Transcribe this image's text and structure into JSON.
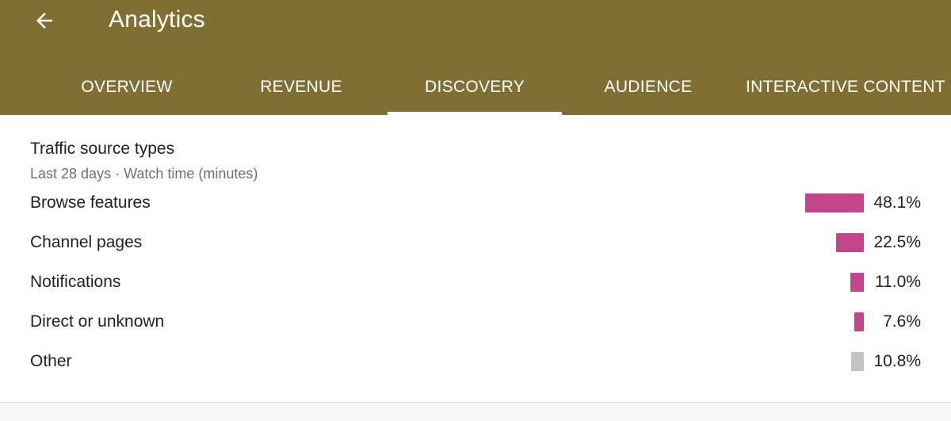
{
  "appbar": {
    "title": "Analytics",
    "back_icon": "arrow-left-icon",
    "background_color": "#806f33"
  },
  "tabs": [
    {
      "label": "OVERVIEW",
      "active": false
    },
    {
      "label": "REVENUE",
      "active": false
    },
    {
      "label": "DISCOVERY",
      "active": true
    },
    {
      "label": "AUDIENCE",
      "active": false
    },
    {
      "label": "INTERACTIVE CONTENT",
      "active": false
    }
  ],
  "traffic_card": {
    "title": "Traffic source types",
    "subtitle": "Last 28 days · Watch time (minutes)",
    "bar_color": "#c2448a",
    "other_bar_color": "#c4c4c4",
    "rows": [
      {
        "label": "Browse features",
        "value": "48.1%",
        "share": 0.481
      },
      {
        "label": "Channel pages",
        "value": "22.5%",
        "share": 0.225
      },
      {
        "label": "Notifications",
        "value": "11.0%",
        "share": 0.11
      },
      {
        "label": "Direct or unknown",
        "value": "7.6%",
        "share": 0.076
      },
      {
        "label": "Other",
        "value": "10.8%",
        "share": 0.108
      }
    ]
  }
}
